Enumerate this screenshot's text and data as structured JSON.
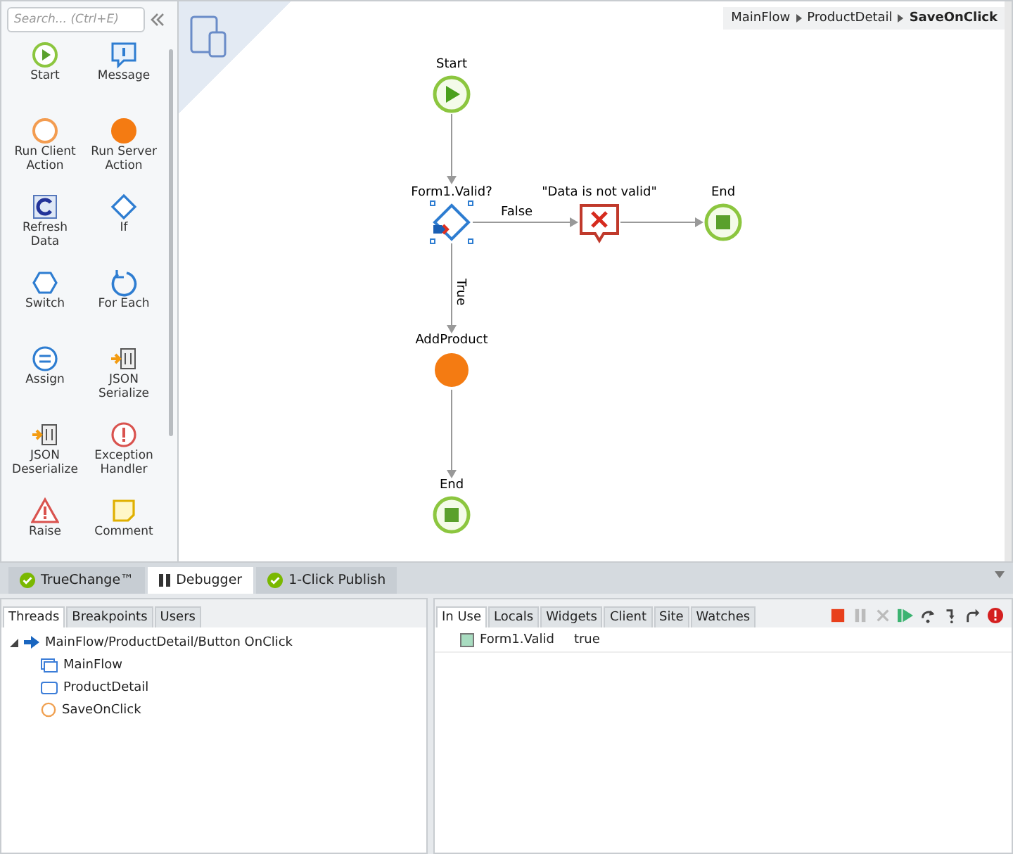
{
  "toolbox": {
    "search": {
      "placeholder": "Search... (Ctrl+E)"
    },
    "items": [
      {
        "label": "Start",
        "kind": "start"
      },
      {
        "label": "Message",
        "kind": "message"
      },
      {
        "label": "Run Client Action",
        "kind": "client"
      },
      {
        "label": "Run Server Action",
        "kind": "server"
      },
      {
        "label": "Refresh Data",
        "kind": "refresh"
      },
      {
        "label": "If",
        "kind": "if"
      },
      {
        "label": "Switch",
        "kind": "switch"
      },
      {
        "label": "For Each",
        "kind": "foreach"
      },
      {
        "label": "Assign",
        "kind": "assign"
      },
      {
        "label": "JSON Serialize",
        "kind": "json"
      },
      {
        "label": "JSON Deserialize",
        "kind": "json"
      },
      {
        "label": "Exception Handler",
        "kind": "exception"
      },
      {
        "label": "Raise",
        "kind": "raise"
      },
      {
        "label": "Comment",
        "kind": "comment"
      }
    ]
  },
  "canvas": {
    "breadcrumb": [
      {
        "label": "MainFlow",
        "current": false
      },
      {
        "label": "ProductDetail",
        "current": false
      },
      {
        "label": "SaveOnClick",
        "current": true
      }
    ],
    "nodes": [
      {
        "label": "Start",
        "kind": "start",
        "selected": false
      },
      {
        "label": "Form1.Valid?",
        "kind": "if",
        "selected": true
      },
      {
        "label": "\"Data is not valid\"",
        "kind": "message",
        "selected": false
      },
      {
        "label": "End",
        "kind": "end",
        "selected": false
      },
      {
        "label": "AddProduct",
        "kind": "server",
        "selected": false
      },
      {
        "label": "End",
        "kind": "end",
        "selected": false
      }
    ],
    "edges": [
      {
        "kind": "plain"
      },
      {
        "kind": "labeled",
        "label": "False"
      },
      {
        "kind": "plain"
      },
      {
        "kind": "labeled",
        "label": "True"
      },
      {
        "kind": "plain"
      }
    ]
  },
  "bottom_tabs": [
    {
      "label": "TrueChange™",
      "kind": "check",
      "selected": false
    },
    {
      "label": "Debugger",
      "kind": "pause",
      "selected": true
    },
    {
      "label": "1-Click Publish",
      "kind": "check",
      "selected": false
    }
  ],
  "threads_panel": {
    "tabs": [
      {
        "label": "Threads",
        "selected": true
      },
      {
        "label": "Breakpoints",
        "selected": false
      },
      {
        "label": "Users",
        "selected": false
      }
    ],
    "tree": [
      {
        "label": "MainFlow/ProductDetail/Button OnClick",
        "kind": "thread",
        "expanded": true,
        "children": [
          {
            "label": "MainFlow",
            "kind": "flow"
          },
          {
            "label": "ProductDetail",
            "kind": "screen"
          },
          {
            "label": "SaveOnClick",
            "kind": "action"
          }
        ]
      }
    ]
  },
  "values_panel": {
    "tabs": [
      {
        "label": "In Use",
        "selected": true
      },
      {
        "label": "Locals",
        "selected": false
      },
      {
        "label": "Widgets",
        "selected": false
      },
      {
        "label": "Client",
        "selected": false
      },
      {
        "label": "Site",
        "selected": false
      },
      {
        "label": "Watches",
        "selected": false
      }
    ],
    "toolbar": [
      {
        "kind": "stop",
        "disabled": false
      },
      {
        "kind": "pause",
        "disabled": true
      },
      {
        "kind": "abort",
        "disabled": true
      },
      {
        "kind": "continue",
        "disabled": false
      },
      {
        "kind": "step-over",
        "disabled": false
      },
      {
        "kind": "step-into",
        "disabled": false
      },
      {
        "kind": "step-out",
        "disabled": false
      },
      {
        "kind": "break-on-exception",
        "disabled": false
      }
    ],
    "variables": [
      {
        "name": "Form1.Valid",
        "value": "true"
      }
    ]
  }
}
